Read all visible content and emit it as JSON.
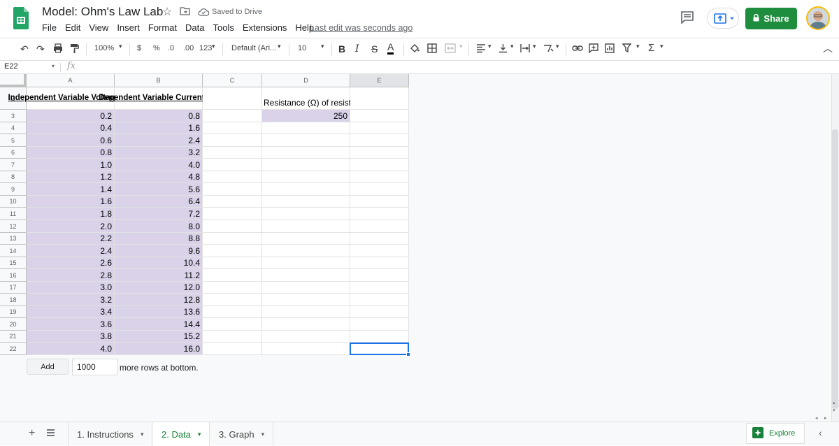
{
  "header": {
    "title": "Model: Ohm's Law Lab",
    "saved_status": "Saved to Drive",
    "menu": [
      "File",
      "Edit",
      "View",
      "Insert",
      "Format",
      "Data",
      "Tools",
      "Extensions",
      "Help"
    ],
    "last_edit": "Last edit was seconds ago",
    "share_label": "Share"
  },
  "toolbar": {
    "zoom": "100%",
    "currency": "$",
    "percent": "%",
    "decrease_decimal": ".0",
    "increase_decimal": ".00",
    "more_formats": "123",
    "font": "Default (Ari...",
    "font_size": "10",
    "bold": "B",
    "italic": "I",
    "strike": "S",
    "text_color": "A"
  },
  "formula_bar": {
    "name_box": "E22",
    "fx": "fx"
  },
  "grid": {
    "columns": [
      "A",
      "B",
      "C",
      "D",
      "E"
    ],
    "row_numbers": [
      "2",
      "3",
      "4",
      "5",
      "6",
      "7",
      "8",
      "9",
      "10",
      "11",
      "12",
      "13",
      "14",
      "15",
      "16",
      "17",
      "18",
      "19",
      "20",
      "21",
      "22"
    ],
    "col_a_header": "Independent Variable Voltage (V)",
    "col_b_header": "Dependent Variable Current (A)",
    "d2_label": "Resistance (Ω) of resistor",
    "d3_value": "250",
    "voltage": [
      "0.2",
      "0.4",
      "0.6",
      "0.8",
      "1.0",
      "1.2",
      "1.4",
      "1.6",
      "1.8",
      "2.0",
      "2.2",
      "2.4",
      "2.6",
      "2.8",
      "3.0",
      "3.2",
      "3.4",
      "3.6",
      "3.8",
      "4.0"
    ],
    "current": [
      "0.8",
      "1.6",
      "2.4",
      "3.2",
      "4.0",
      "4.8",
      "5.6",
      "6.4",
      "7.2",
      "8.0",
      "8.8",
      "9.6",
      "10.4",
      "11.2",
      "12.0",
      "12.8",
      "13.6",
      "14.4",
      "15.2",
      "16.0"
    ],
    "selected_cell": "E22",
    "shade_color": "#d9d2e9",
    "selection_color": "#1a73e8"
  },
  "add_rows": {
    "button_label": "Add",
    "count": "1000",
    "suffix": "more rows at bottom."
  },
  "sheets": {
    "tabs": [
      {
        "label": "1. Instructions",
        "active": false
      },
      {
        "label": "2. Data",
        "active": true
      },
      {
        "label": "3. Graph",
        "active": false
      }
    ],
    "explore_label": "Explore"
  },
  "colors": {
    "share_green": "#1e8e3e",
    "active_tab_green": "#188038"
  }
}
